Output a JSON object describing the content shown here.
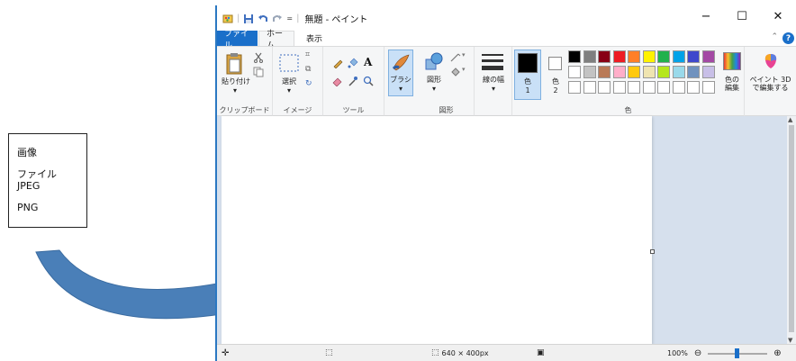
{
  "side_box": {
    "lines": [
      "画像",
      "ファイル",
      "JPEG",
      "PNG"
    ]
  },
  "window": {
    "title": "無題 - ペイント"
  },
  "tabs": {
    "file": "ファイル",
    "home": "ホーム",
    "view": "表示"
  },
  "ribbon": {
    "clipboard": {
      "paste": "貼り付け",
      "group": "クリップボード"
    },
    "image": {
      "select": "選択",
      "group": "イメージ"
    },
    "tools": {
      "group": "ツール"
    },
    "brush": "ブラシ",
    "shapes": {
      "shapes": "図形",
      "group": "図形"
    },
    "size": "線の幅",
    "color1": {
      "label": "色",
      "num": "1"
    },
    "color2": {
      "label": "色",
      "num": "2"
    },
    "edit_colors": [
      "色の",
      "編集"
    ],
    "colors_group": "色",
    "paint3d": [
      "ペイント 3D",
      "で編集する"
    ]
  },
  "palette": {
    "row1": [
      "#000000",
      "#7f7f7f",
      "#880015",
      "#ed1c24",
      "#ff7f27",
      "#fff200",
      "#22b14c",
      "#00a2e8",
      "#3f48cc",
      "#a349a4"
    ],
    "row2": [
      "#ffffff",
      "#c3c3c3",
      "#b97a57",
      "#ffaec9",
      "#ffc90e",
      "#efe4b0",
      "#b5e61d",
      "#99d9ea",
      "#7092be",
      "#c8bfe7"
    ],
    "row3": [
      "#ffffff",
      "#ffffff",
      "#ffffff",
      "#ffffff",
      "#ffffff",
      "#ffffff",
      "#ffffff",
      "#ffffff",
      "#ffffff",
      "#ffffff"
    ]
  },
  "colors": {
    "accent": "#1a6fc9",
    "arrow": "#4a7fb8"
  },
  "status": {
    "dimensions": "640 × 400px",
    "zoom": "100%"
  }
}
